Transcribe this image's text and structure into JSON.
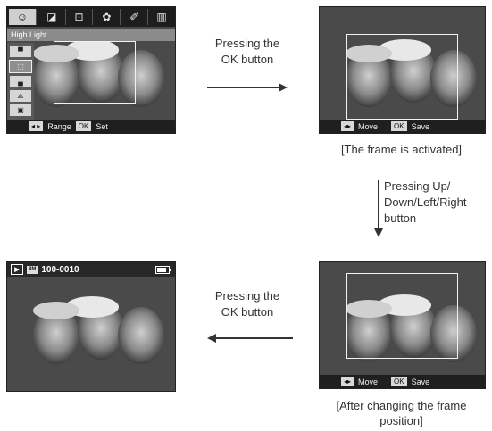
{
  "screen1": {
    "menu_icons": [
      "☺",
      "◪",
      "⊡",
      "✿",
      "✐",
      "▥"
    ],
    "menu_title": "High Light",
    "side_items": [
      "▀",
      "⬚",
      "▄",
      "⟁",
      "▣"
    ],
    "bottom": {
      "nav_key": "◂ ▸",
      "range_label": "Range",
      "ok_key": "OK",
      "set_label": "Set"
    }
  },
  "screen2": {
    "bottom": {
      "move_key": "◂▸",
      "move_label": "Move",
      "ok_key": "OK",
      "save_label": "Save"
    }
  },
  "screen3": {
    "bottom": {
      "move_key": "◂▸",
      "move_label": "Move",
      "ok_key": "OK",
      "save_label": "Save"
    }
  },
  "screen4": {
    "file_number": "100-0010",
    "res_icon": "8M",
    "battery_level": 0.85
  },
  "labels": {
    "press_ok_top_1": "Pressing the",
    "press_ok_top_2": "OK button",
    "caption_activated": "[The frame is activated]",
    "press_dir_1": "Pressing Up/",
    "press_dir_2": "Down/Left/Right",
    "press_dir_3": "button",
    "press_ok_bottom_1": "Pressing the",
    "press_ok_bottom_2": "OK button",
    "caption_changed_1": "[After changing the frame",
    "caption_changed_2": "position]"
  },
  "colors": {
    "photo_bg": "#3a3a3a",
    "bar_dark": "#1f1f1f",
    "frame": "#f2f2f2"
  }
}
